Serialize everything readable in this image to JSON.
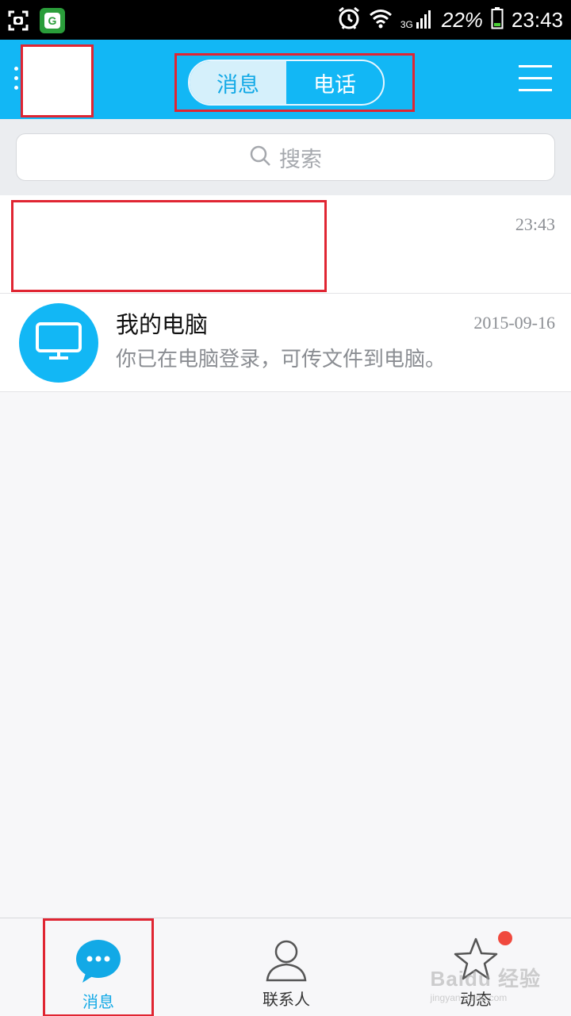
{
  "status_bar": {
    "network": "3G",
    "battery": "22%",
    "time": "23:43"
  },
  "header": {
    "tabs": [
      {
        "label": "消息",
        "active": true
      },
      {
        "label": "电话",
        "active": false
      }
    ]
  },
  "search": {
    "placeholder": "搜索"
  },
  "conversations": [
    {
      "title": "",
      "subtitle": "",
      "time": "23:43",
      "redacted": true
    },
    {
      "title": "我的电脑",
      "subtitle": "你已在电脑登录，可传文件到电脑。",
      "time": "2015-09-16",
      "avatar_icon": "computer-icon"
    }
  ],
  "bottom_nav": {
    "items": [
      {
        "label": "消息",
        "icon": "message-bubble-icon",
        "active": true
      },
      {
        "label": "联系人",
        "icon": "contacts-icon",
        "active": false
      },
      {
        "label": "动态",
        "icon": "star-icon",
        "active": false,
        "badge": true
      }
    ]
  },
  "watermark": {
    "text": "Baidu 经验",
    "sub": "jingyan.baidu.com"
  },
  "colors": {
    "header": "#12b7f5",
    "accent": "#12a9e6",
    "highlight_border": "#e02532",
    "badge": "#f0493e"
  }
}
